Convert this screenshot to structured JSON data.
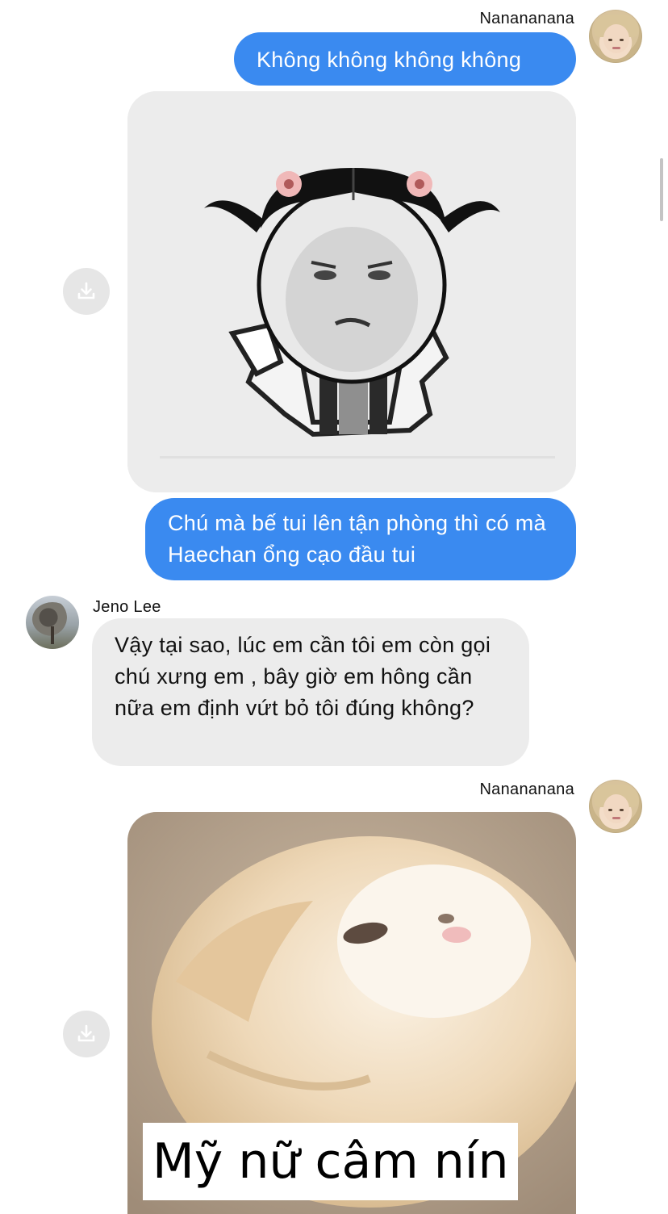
{
  "messages": [
    {
      "sender": "Nanananana",
      "text": "Không không không không"
    },
    {
      "sender": "Nanananana",
      "image_desc": "sticker-girl-pigtails-grumpy"
    },
    {
      "sender": "Nanananana",
      "text": "Chú mà bế tui lên tận phòng thì có mà Haechan ổng cạo đầu tui"
    },
    {
      "sender": "Jeno Lee",
      "text": "Vậy tại sao, lúc em cần tôi em còn gọi chú xưng em , bây giờ em hông cần nữa em định vứt bỏ tôi đúng không?"
    },
    {
      "sender": "Nanananana",
      "image_caption": "Mỹ nữ câm nín"
    }
  ],
  "colors": {
    "outgoing_bubble": "#3a8af0",
    "incoming_bubble": "#ececec",
    "background": "#ffffff"
  },
  "icons": {
    "download": "download-icon"
  }
}
